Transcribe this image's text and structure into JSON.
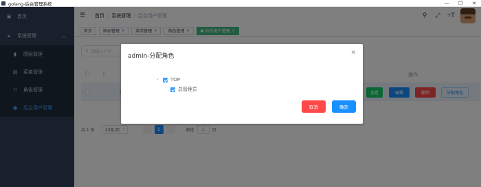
{
  "window": {
    "title": "golang-后台管理系统",
    "controls": [
      "—",
      "❐",
      "✕"
    ]
  },
  "sidebar": {
    "items": [
      {
        "label": "首页",
        "icon": "dashboard-icon"
      },
      {
        "label": "系统管理",
        "icon": "lock-icon",
        "expanded": true
      }
    ],
    "sub_items": [
      {
        "label": "图标管理",
        "icon": "book-icon"
      },
      {
        "label": "菜单管理",
        "icon": "document-icon"
      },
      {
        "label": "角色管理",
        "icon": "user-group-icon"
      },
      {
        "label": "后台用户管理",
        "icon": "user-icon",
        "active": true
      }
    ]
  },
  "navbar": {
    "breadcrumb": [
      "首页",
      "系统管理",
      "后台用户管理"
    ],
    "icons": [
      "search-icon",
      "fullscreen-icon",
      "font-size-icon"
    ]
  },
  "tags": [
    {
      "label": "首页"
    },
    {
      "label": "图标管理"
    },
    {
      "label": "菜单管理"
    },
    {
      "label": "角色管理"
    },
    {
      "label": "后台用户管理",
      "active": true
    }
  ],
  "main": {
    "search_placeholder": "请输入户名",
    "table": {
      "header_ops": "操作",
      "row_partial": "a",
      "buttons": [
        "查看",
        "编辑",
        "删除",
        "分配角色"
      ]
    },
    "pager": {
      "total": "共 1 条",
      "size": "20条/页",
      "page": "1",
      "goto": "前往",
      "goto_value": "1",
      "page_suffix": "页"
    }
  },
  "dialog": {
    "title": "admin-分配角色",
    "tree": {
      "root": "TOP",
      "child": "总管理员"
    },
    "cancel": "取消",
    "ok": "确定"
  },
  "colors": {
    "sidebar_bg": "#304156",
    "primary": "#1890ff",
    "danger": "#ff4949",
    "success": "#13ce66",
    "tag_active": "#42b983"
  }
}
